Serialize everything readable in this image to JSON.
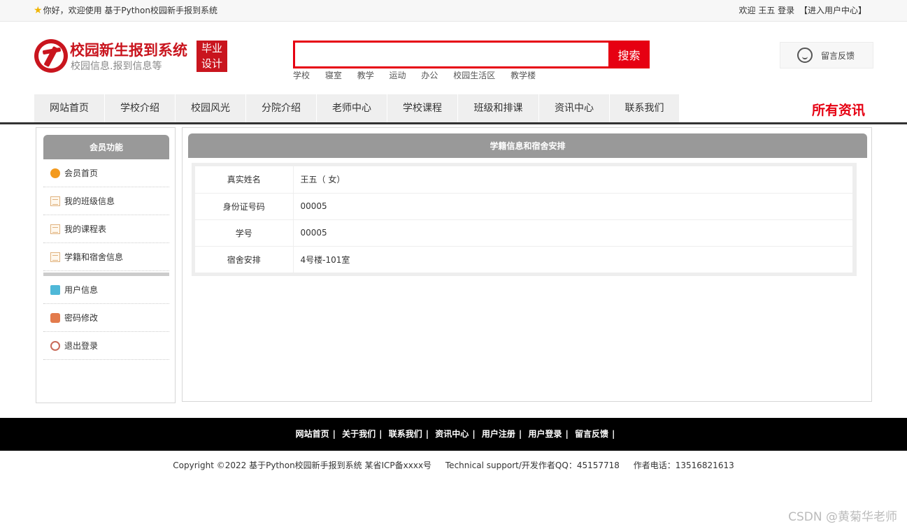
{
  "topbar": {
    "welcome": "你好，欢迎使用 基于Python校园新手报到系统",
    "greeting": "欢迎 王五 登录",
    "user_center": "【进入用户中心】"
  },
  "header": {
    "site_title": "校园新生报到系统",
    "site_subtitle": "校园信息.报到信息等",
    "badge_line1": "毕业",
    "badge_line2": "设计",
    "search_placeholder": "",
    "search_button": "搜索",
    "hot_words": [
      "学校",
      "寝室",
      "教学",
      "运动",
      "办公",
      "校园生活区",
      "教学楼"
    ],
    "feedback": "留言反馈"
  },
  "nav": {
    "items": [
      "网站首页",
      "学校介绍",
      "校园风光",
      "分院介绍",
      "老师中心",
      "学校课程",
      "班级和排课",
      "资讯中心",
      "联系我们"
    ],
    "all_news": "所有资讯"
  },
  "sidebar": {
    "title": "会员功能",
    "items": [
      "会员首页",
      "我的班级信息",
      "我的课程表",
      "学籍和宿舍信息",
      "用户信息",
      "密码修改",
      "退出登录"
    ]
  },
  "content": {
    "title": "学籍信息和宿舍安排",
    "rows": [
      {
        "label": "真实姓名",
        "value": "王五（ 女）"
      },
      {
        "label": "身份证号码",
        "value": "00005"
      },
      {
        "label": "学号",
        "value": "00005"
      },
      {
        "label": "宿舍安排",
        "value": "4号楼-101室"
      }
    ]
  },
  "footer": {
    "links": [
      "网站首页",
      "关于我们",
      "联系我们",
      "资讯中心",
      "用户注册",
      "用户登录",
      "留言反馈"
    ],
    "copyright": "Copyright ©2022 基于Python校园新手报到系统 某省ICP备xxxx号",
    "support": "Technical support/开发作者QQ：45157718",
    "phone": "作者电话：13516821613"
  },
  "watermark": "CSDN @黄菊华老师",
  "colors": {
    "accent": "#e60012",
    "brand": "#c9151e",
    "panel_head": "#999999"
  }
}
